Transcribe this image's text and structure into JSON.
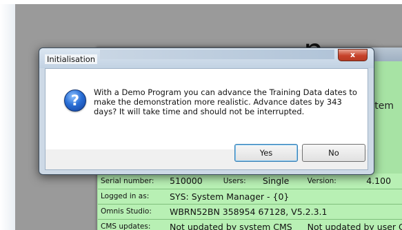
{
  "dialog": {
    "title": "Initialisation",
    "close_glyph": "x",
    "icon": "question-icon",
    "message": "With a Demo Program you can advance the Training Data dates to make the demonstration more realistic. Advance dates by 343 days? It will take time and should not be interrupted.",
    "yes_label": "Yes",
    "no_label": "No"
  },
  "background": {
    "big_text": "n",
    "side_text": "stem",
    "rows": [
      {
        "label": "Serial number:",
        "value": "510000",
        "label2": "Users:",
        "value2": "Single",
        "label3": "Version:",
        "value3": "4.100"
      },
      {
        "label": "Logged in as:",
        "value": "SYS: System Manager -  {0}"
      },
      {
        "label": "Omnis Studio:",
        "value": "WBRN52BN 358954 67128, V5.2.3.1"
      },
      {
        "label": "CMS updates:",
        "value": "Not updated by system CMS",
        "value2": "Not updated by user C"
      }
    ]
  },
  "colors": {
    "app_background": "#9a9a9a",
    "green_panel": "#b8f0b4",
    "dialog_frame": "#cdd9e6",
    "close_button": "#c7422a"
  }
}
